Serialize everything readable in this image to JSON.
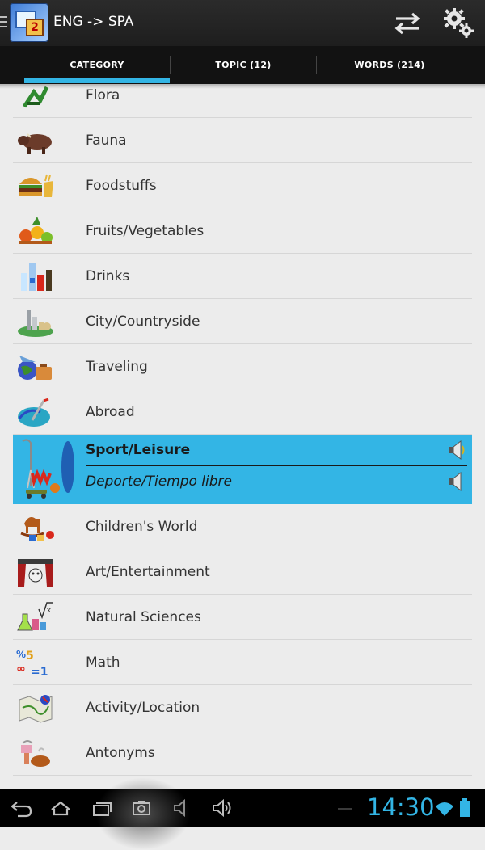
{
  "app": {
    "title": "ENG -> SPA"
  },
  "tabs": [
    {
      "label": "CATEGORY",
      "selected": true
    },
    {
      "label": "TOPIC (12)",
      "selected": false
    },
    {
      "label": "WORDS (214)",
      "selected": false
    }
  ],
  "categories": [
    {
      "label": "Flora",
      "icon": "plant-icon"
    },
    {
      "label": "Fauna",
      "icon": "boar-icon"
    },
    {
      "label": "Foodstuffs",
      "icon": "burger-icon"
    },
    {
      "label": "Fruits/Vegetables",
      "icon": "fruit-basket-icon"
    },
    {
      "label": "Drinks",
      "icon": "bottles-icon"
    },
    {
      "label": "City/Countryside",
      "icon": "city-icon"
    },
    {
      "label": "Traveling",
      "icon": "globe-luggage-icon"
    },
    {
      "label": "Abroad",
      "icon": "map-icon"
    },
    {
      "label": "Sport/Leisure",
      "translation": "Deporte/Tiempo libre",
      "icon": "sports-icon",
      "selected": true
    },
    {
      "label": "Children's World",
      "icon": "rocking-horse-icon"
    },
    {
      "label": "Art/Entertainment",
      "icon": "theater-icon"
    },
    {
      "label": "Natural Sciences",
      "icon": "science-icon"
    },
    {
      "label": "Math",
      "icon": "math-icon"
    },
    {
      "label": "Activity/Location",
      "icon": "location-map-icon"
    },
    {
      "label": "Antonyms",
      "icon": "antonyms-icon"
    }
  ],
  "status": {
    "time": "14:30"
  },
  "colors": {
    "accent": "#33b5e5",
    "actionbar": "#222222",
    "tabbar": "#121212"
  }
}
